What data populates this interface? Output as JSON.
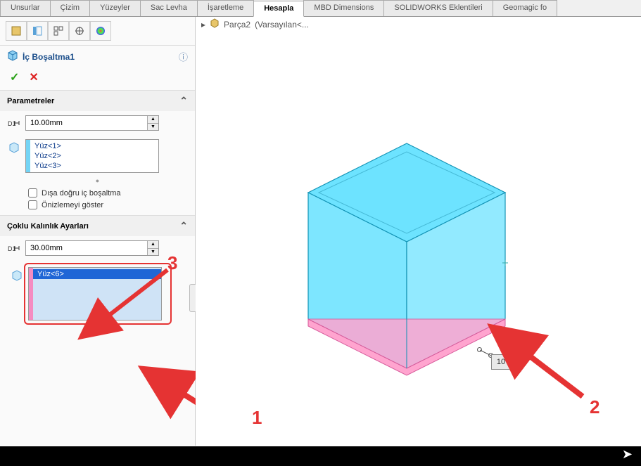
{
  "tabs": [
    "Unsurlar",
    "Çizim",
    "Yüzeyler",
    "Sac Levha",
    "İşaretleme",
    "Hesapla",
    "MBD Dimensions",
    "SOLIDWORKS Eklentileri",
    "Geomagic fo"
  ],
  "active_tab_index": 5,
  "breadcrumb": {
    "arrow": "▸",
    "part": "Parça2",
    "state": "(Varsayılan<..."
  },
  "feature": {
    "title": "İç Boşaltma1"
  },
  "sections": {
    "parametreler": {
      "title": "Parametreler",
      "distance": "10.00mm",
      "faces": [
        "Yüz<1>",
        "Yüz<2>",
        "Yüz<3>"
      ],
      "opt_shell_outward": "Dışa doğru iç boşaltma",
      "opt_show_preview": "Önizlemeyi göster"
    },
    "coklu": {
      "title": "Çoklu Kalınlık Ayarları",
      "distance": "30.00mm",
      "faces": [
        "Yüz<6>"
      ]
    }
  },
  "dim_value": "10",
  "callouts": {
    "one": "1",
    "two": "2",
    "three": "3"
  }
}
